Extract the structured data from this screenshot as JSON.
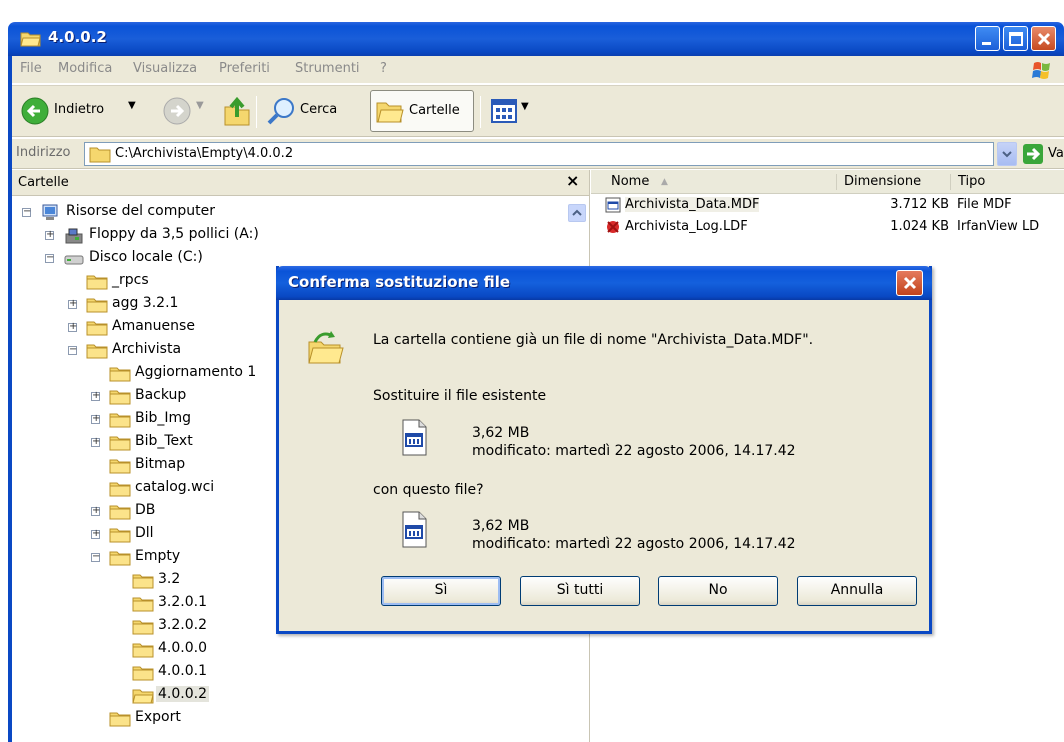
{
  "window": {
    "title": "4.0.0.2"
  },
  "menu": [
    "File",
    "Modifica",
    "Visualizza",
    "Preferiti",
    "Strumenti",
    "?"
  ],
  "toolbar": {
    "back_label": "Indietro",
    "search_label": "Cerca",
    "folders_label": "Cartelle"
  },
  "address": {
    "label": "Indirizzo",
    "value": "C:\\Archivista\\Empty\\4.0.0.2",
    "go_label": "Vai"
  },
  "folders_pane": {
    "title": "Cartelle",
    "close": "×",
    "items": [
      {
        "label": "Risorse del computer",
        "expander": "−",
        "icon": "computer-icon"
      },
      {
        "label": "Floppy da 3,5 pollici (A:)",
        "expander": "+",
        "icon": "floppy-icon"
      },
      {
        "label": "Disco locale (C:)",
        "expander": "−",
        "icon": "drive-icon"
      },
      {
        "label": "_rpcs",
        "expander": "",
        "icon": "folder-icon"
      },
      {
        "label": "agg 3.2.1",
        "expander": "+",
        "icon": "folder-icon"
      },
      {
        "label": "Amanuense",
        "expander": "+",
        "icon": "folder-icon"
      },
      {
        "label": "Archivista",
        "expander": "−",
        "icon": "folder-icon"
      },
      {
        "label": "Aggiornamento 1",
        "expander": "",
        "icon": "folder-icon"
      },
      {
        "label": "Backup",
        "expander": "+",
        "icon": "folder-icon"
      },
      {
        "label": "Bib_Img",
        "expander": "+",
        "icon": "folder-icon"
      },
      {
        "label": "Bib_Text",
        "expander": "+",
        "icon": "folder-icon"
      },
      {
        "label": "Bitmap",
        "expander": "",
        "icon": "folder-icon"
      },
      {
        "label": "catalog.wci",
        "expander": "",
        "icon": "folder-icon"
      },
      {
        "label": "DB",
        "expander": "+",
        "icon": "folder-icon"
      },
      {
        "label": "Dll",
        "expander": "+",
        "icon": "folder-icon"
      },
      {
        "label": "Empty",
        "expander": "−",
        "icon": "folder-icon"
      },
      {
        "label": "3.2",
        "expander": "",
        "icon": "folder-icon"
      },
      {
        "label": "3.2.0.1",
        "expander": "",
        "icon": "folder-icon"
      },
      {
        "label": "3.2.0.2",
        "expander": "",
        "icon": "folder-icon"
      },
      {
        "label": "4.0.0.0",
        "expander": "",
        "icon": "folder-icon"
      },
      {
        "label": "4.0.0.1",
        "expander": "",
        "icon": "folder-icon"
      },
      {
        "label": "4.0.0.2",
        "expander": "",
        "icon": "folder-open-icon"
      },
      {
        "label": "Export",
        "expander": "",
        "icon": "folder-icon"
      }
    ]
  },
  "file_list": {
    "columns": {
      "name": "Nome",
      "size": "Dimensione",
      "type": "Tipo"
    },
    "sort_indicator": "▲",
    "rows": [
      {
        "name": "Archivista_Data.MDF",
        "size": "3.712 KB",
        "type": "File MDF",
        "icon": "mdf-file-icon"
      },
      {
        "name": "Archivista_Log.LDF",
        "size": "1.024 KB",
        "type": "IrfanView LD",
        "icon": "irfanview-file-icon"
      }
    ]
  },
  "dialog": {
    "title": "Conferma sostituzione file",
    "message": "La cartella contiene già un file di nome \"Archivista_Data.MDF\".",
    "replace_prompt": "Sostituire il file esistente",
    "existing_file": {
      "size": "3,62 MB",
      "modified": "modificato:  martedì 22 agosto 2006, 14.17.42"
    },
    "with_prompt": "con questo file?",
    "new_file": {
      "size": "3,62 MB",
      "modified": "modificato:  martedì 22 agosto 2006, 14.17.42"
    },
    "buttons": {
      "yes": "Sì",
      "yes_all": "Sì tutti",
      "no": "No",
      "cancel": "Annulla"
    }
  }
}
